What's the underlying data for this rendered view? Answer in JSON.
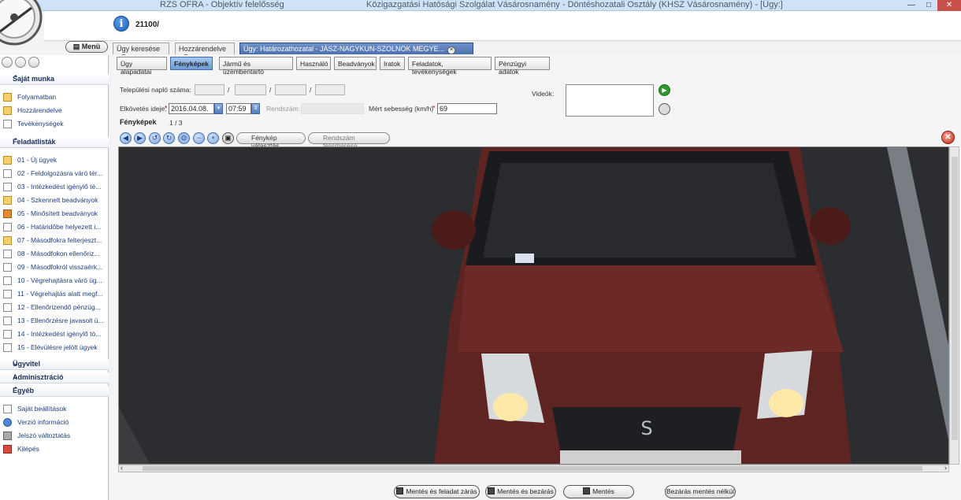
{
  "window": {
    "app_title": "RZS OFRA - Objektív felelősség",
    "context_title": "Közigazgatási Hatósági Szolgálat Vásárosnamény - Döntéshozatali Osztály (KHSZ Vásárosnamény) - [Ügy:]",
    "case_number": "21100/",
    "controls": [
      "—",
      "□",
      "✕"
    ]
  },
  "menu_button": "Menü",
  "doc_tabs": [
    {
      "label": "Ügy keresése",
      "active": false
    },
    {
      "label": "Hozzárendelve",
      "active": false
    },
    {
      "label": "Ügy: Határozathozatal - JÁSZ-NAGYKUN-SZOLNOK MEGYE...",
      "active": true
    }
  ],
  "sidebar": {
    "sections": [
      {
        "label": "Saját munka",
        "chevron": "⌃"
      },
      {
        "label": "Feladatlisták",
        "chevron": "⌃"
      },
      {
        "label": "Ügyvitel",
        "chevron": "⌄"
      },
      {
        "label": "Adminisztráció",
        "chevron": "⌄"
      },
      {
        "label": "Egyéb",
        "chevron": "⌃"
      }
    ],
    "own_work": [
      "Folyamatban",
      "Hozzárendelve",
      "Tevékenységek"
    ],
    "task_lists": [
      "01 - Új ügyek",
      "02 - Feldolgozásra váró tér...",
      "03 - Intézkedést igénylő té...",
      "04 - Szkennelt beadványok",
      "05 - Minősített beadványok",
      "06 - Határidőbe helyezett i...",
      "07 - Másodfokra felterjeszt...",
      "08 - Másodfokon ellenőriz...",
      "09 - Másodfokról visszaérk...",
      "10 - Végrehajtásra váró üg...",
      "11 - Végrehajtás alatt megf...",
      "12 - Ellenőrizendő pénzüg...",
      "13 - Ellenőrzésre javasolt ü...",
      "14 - Intézkedést igénylő tö...",
      "15 - Elévülésre jelölt ügyek"
    ],
    "other": [
      "Saját beállítások",
      "Verzió információ",
      "Jelszó változtatás",
      "Kilépés"
    ]
  },
  "subtabs": [
    {
      "label": "Ügy alapadatai",
      "active": false
    },
    {
      "label": "Fényképek",
      "active": true
    },
    {
      "label": "Jármű és üzembentartó",
      "active": false
    },
    {
      "label": "Használó",
      "active": false
    },
    {
      "label": "Beadványok",
      "active": false
    },
    {
      "label": "Iratok",
      "active": false
    },
    {
      "label": "Feladatok, tevékenységek",
      "active": false
    },
    {
      "label": "Pénzügyi adatok",
      "active": false
    }
  ],
  "form": {
    "log_number_label": "Települési napló száma:",
    "separator": "/",
    "offence_time_label": "Elkövetés ideje:",
    "required_mark": "*",
    "date_value": "2016.04.08.",
    "time_value": "07:59",
    "plate_label": "Rendszám:",
    "speed_label": "Mért sebesség (km/h)",
    "speed_value": "69",
    "videos_label": "Videók:",
    "photos_label": "Fényképek",
    "photo_counter": "1 / 3"
  },
  "photo_toolbar": {
    "select_photo": "Fénykép választás",
    "recognize_plate": "Rendszám felismerése"
  },
  "bottom_buttons": [
    "Mentés és feladat zárás",
    "Mentés és bezárás",
    "Mentés",
    "Bezárás mentés nélkül"
  ],
  "colors": {
    "car_body": "#6b2a26",
    "accent_blue": "#4b71b0",
    "close_red": "#c1321f"
  }
}
